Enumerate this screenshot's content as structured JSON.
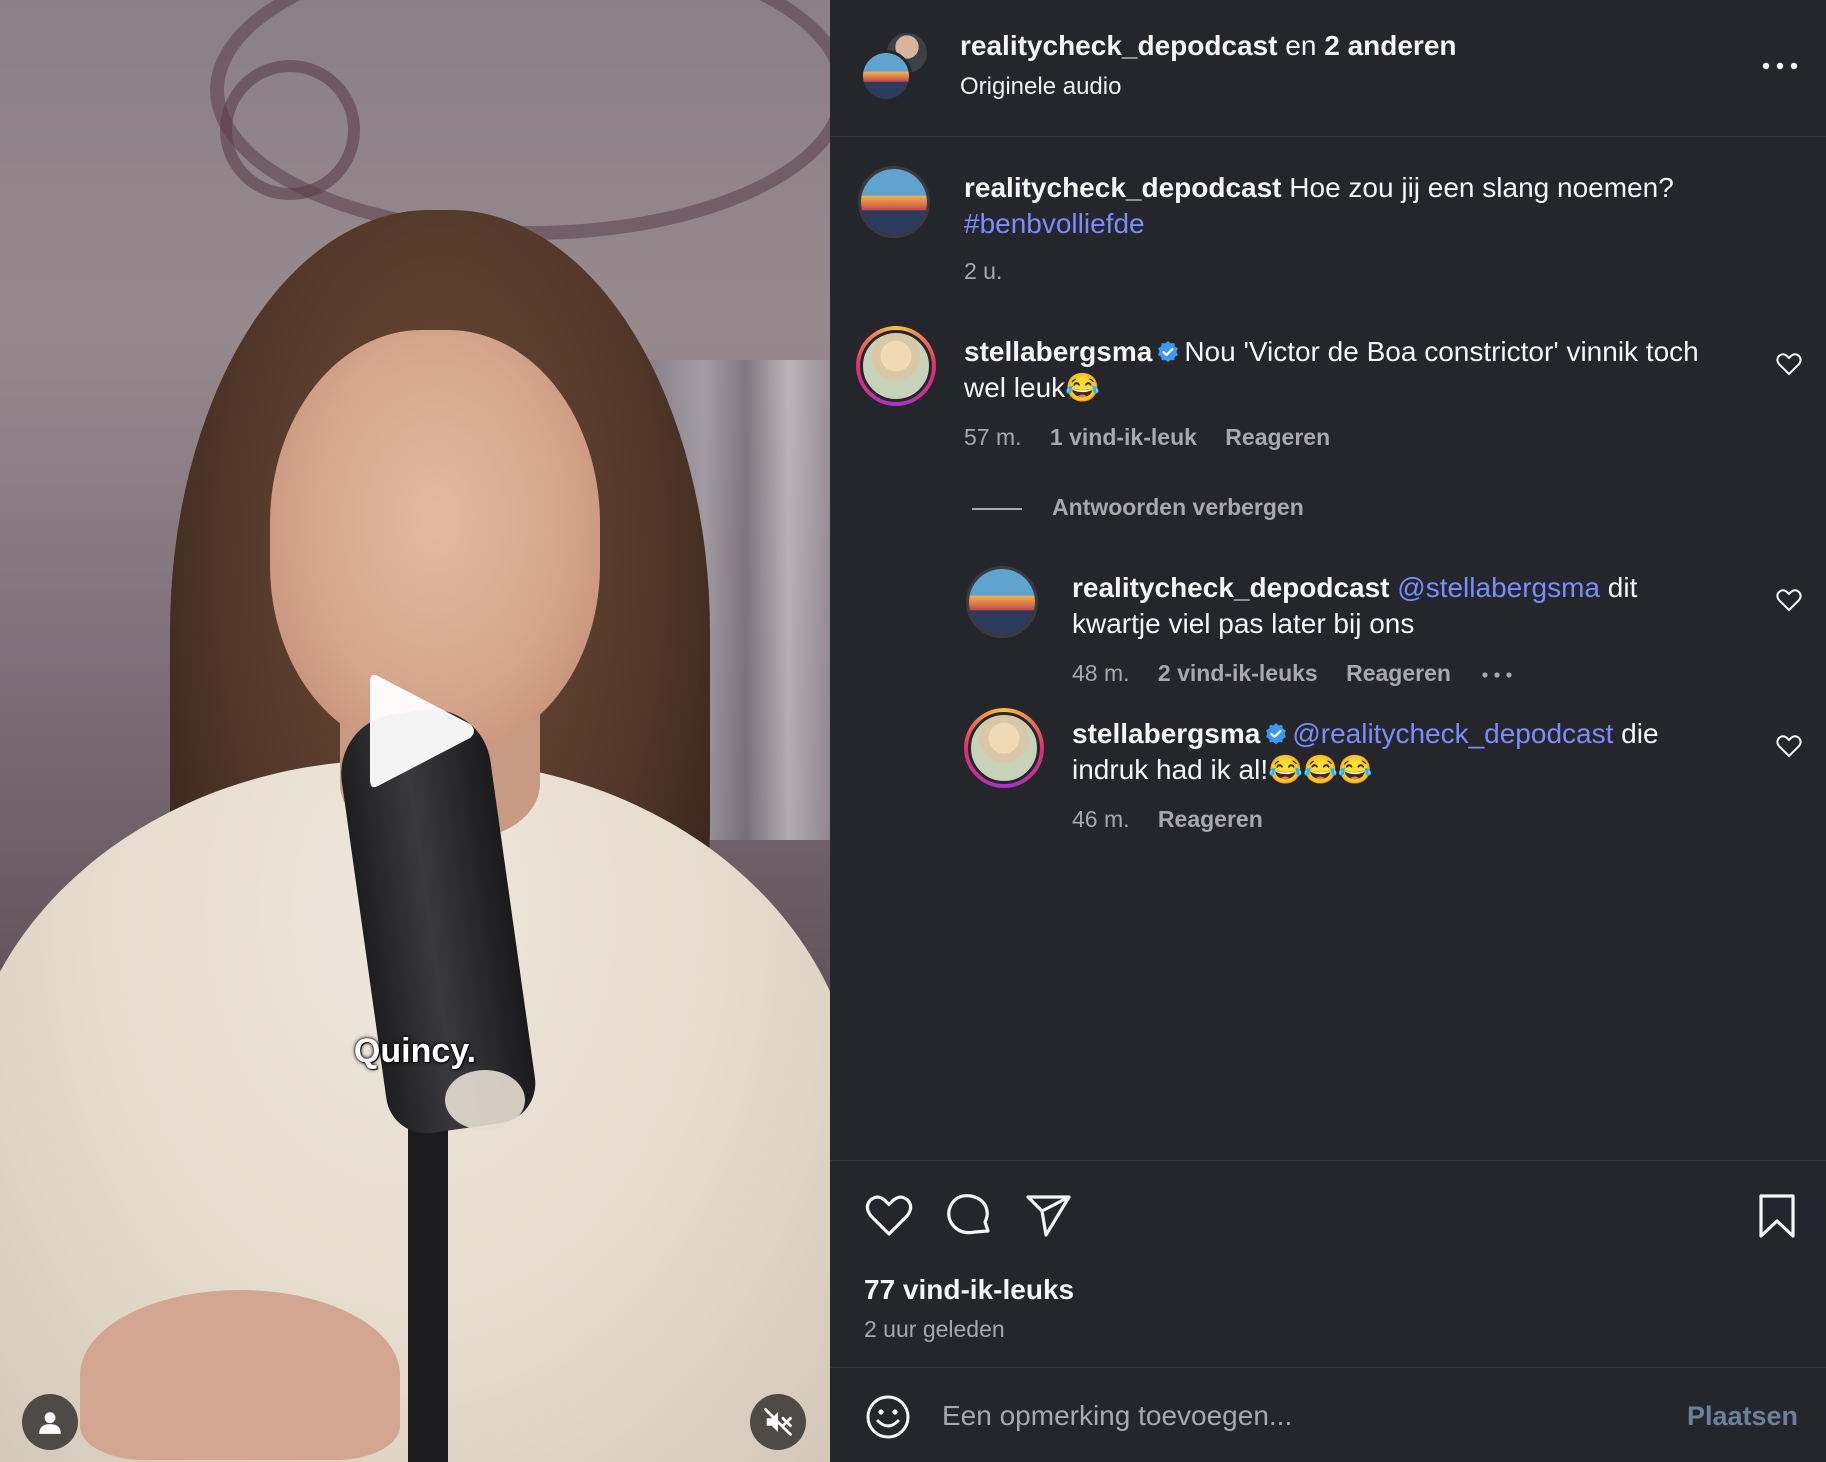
{
  "video": {
    "caption": "Quincy."
  },
  "header": {
    "account": "realitycheck_depodcast",
    "connector": "en",
    "others": "2 anderen",
    "audio": "Originele audio"
  },
  "post": {
    "user": "realitycheck_depodcast",
    "text": "Hoe zou jij een slang noemen?",
    "hashtag": "#benbvolliefde",
    "time": "2 u."
  },
  "comments": [
    {
      "user": "stellabergsma",
      "text_line1": "Nou 'Victor de Boa constrictor' vinnik toch",
      "text_line2": "wel leuk😂",
      "time": "57 m.",
      "likes": "1 vind-ik-leuk",
      "reply": "Reageren"
    }
  ],
  "hide_replies": "Antwoorden verbergen",
  "replies": [
    {
      "user": "realitycheck_depodcast",
      "mention": "@stellabergsma",
      "text_line1_after": "dit",
      "text_line2": "kwartje viel pas later bij ons",
      "time": "48 m.",
      "likes": "2 vind-ik-leuks",
      "reply": "Reageren"
    },
    {
      "user": "stellabergsma",
      "mention": "@realitycheck_depodcast",
      "text_line1_after": "die",
      "text_line2": "indruk had ik al!😂😂😂",
      "time": "46 m.",
      "reply": "Reageren"
    }
  ],
  "footer": {
    "likes": "77 vind-ik-leuks",
    "ago": "2 uur geleden",
    "comment_placeholder": "Een opmerking toevoegen...",
    "post_button": "Plaatsen"
  },
  "colors": {
    "background": "#25262c",
    "link": "#7a8dfb",
    "muted": "#a8a8ad",
    "verified": "#3b97f0",
    "post_button": "#6b8099"
  },
  "icons": [
    "play-icon",
    "user-icon",
    "mute-icon",
    "more-icon",
    "verified-icon",
    "heart-icon",
    "comment-icon",
    "share-icon",
    "bookmark-icon",
    "emoji-icon"
  ]
}
